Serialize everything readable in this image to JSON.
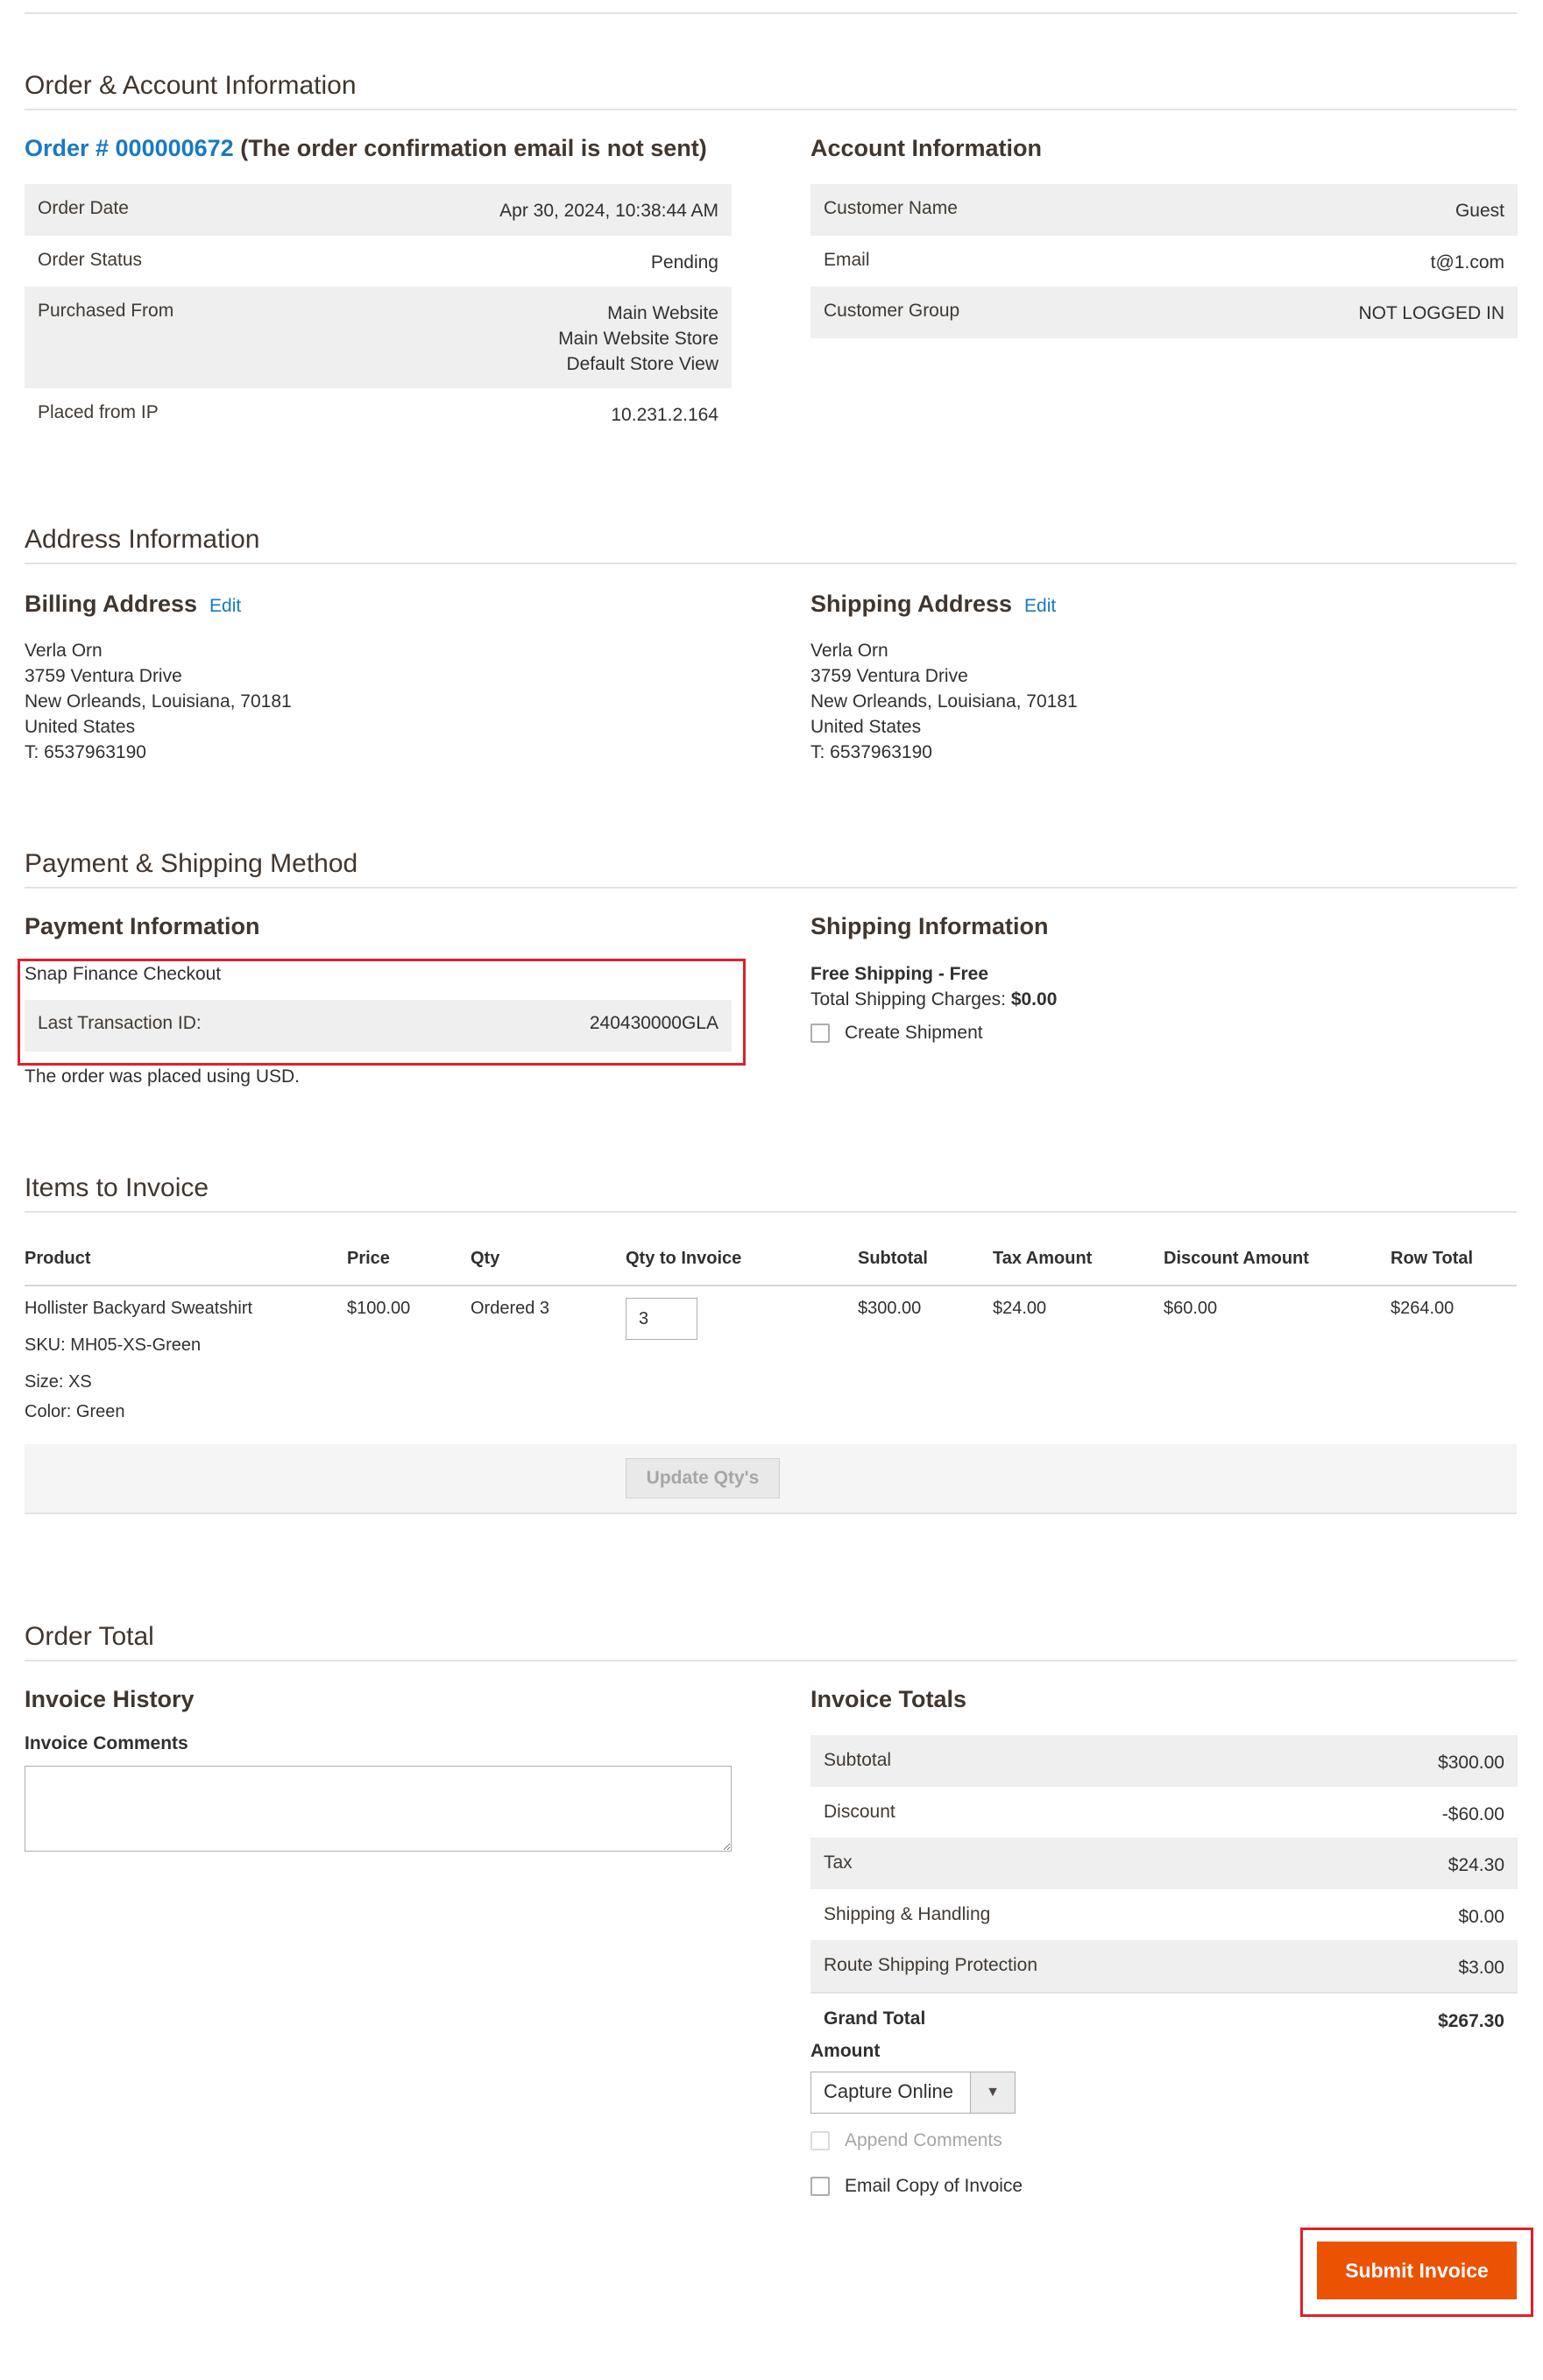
{
  "order_account": {
    "section_title": "Order & Account Information",
    "order_link": "Order # 000000672",
    "order_note": "(The order confirmation email is not sent)",
    "rows": [
      {
        "label": "Order Date",
        "value": "Apr 30, 2024, 10:38:44 AM"
      },
      {
        "label": "Order Status",
        "value": "Pending"
      },
      {
        "label": "Purchased From",
        "value": "Main Website\nMain Website Store\nDefault Store View"
      },
      {
        "label": "Placed from IP",
        "value": "10.231.2.164"
      }
    ],
    "account_title": "Account Information",
    "account_rows": [
      {
        "label": "Customer Name",
        "value": "Guest"
      },
      {
        "label": "Email",
        "value": "t@1.com"
      },
      {
        "label": "Customer Group",
        "value": "NOT LOGGED IN"
      }
    ]
  },
  "address": {
    "section_title": "Address Information",
    "edit_label": "Edit",
    "billing_title": "Billing Address",
    "billing_lines": "Verla Orn\n3759 Ventura Drive\nNew Orleands, Louisiana, 70181\nUnited States\nT: 6537963190",
    "shipping_title": "Shipping Address",
    "shipping_lines": "Verla Orn\n3759 Ventura Drive\nNew Orleands, Louisiana, 70181\nUnited States\nT: 6537963190"
  },
  "payment_shipping": {
    "section_title": "Payment & Shipping Method",
    "payment_title": "Payment Information",
    "payment_method": "Snap Finance Checkout",
    "transaction_label": "Last Transaction ID:",
    "transaction_value": "240430000GLA",
    "currency_note": "The order was placed using USD.",
    "shipping_title": "Shipping Information",
    "shipping_method": "Free Shipping - Free",
    "charges_label": "Total Shipping Charges:",
    "charges_value": "$0.00",
    "create_shipment_label": "Create Shipment"
  },
  "items": {
    "section_title": "Items to Invoice",
    "headers": [
      "Product",
      "Price",
      "Qty",
      "Qty to Invoice",
      "Subtotal",
      "Tax Amount",
      "Discount Amount",
      "Row Total"
    ],
    "row": {
      "product": "Hollister Backyard Sweatshirt",
      "sku": "SKU: MH05-XS-Green",
      "size": "Size: XS",
      "color": "Color: Green",
      "price": "$100.00",
      "qty": "Ordered 3",
      "qty_to_invoice": "3",
      "subtotal": "$300.00",
      "tax": "$24.00",
      "discount": "$60.00",
      "row_total": "$264.00"
    },
    "update_button": "Update Qty's"
  },
  "order_total": {
    "section_title": "Order Total",
    "history_title": "Invoice History",
    "comments_label": "Invoice Comments",
    "totals_title": "Invoice Totals",
    "totals_rows": [
      {
        "label": "Subtotal",
        "value": "$300.00"
      },
      {
        "label": "Discount",
        "value": "-$60.00"
      },
      {
        "label": "Tax",
        "value": "$24.30"
      },
      {
        "label": "Shipping & Handling",
        "value": "$0.00"
      },
      {
        "label": "Route Shipping Protection",
        "value": "$3.00"
      }
    ],
    "grand_total_label": "Grand Total",
    "grand_total_value": "$267.30",
    "amount_label": "Amount",
    "capture_option": "Capture Online",
    "append_comments_label": "Append Comments",
    "email_copy_label": "Email Copy of Invoice",
    "submit_label": "Submit Invoice"
  },
  "colors": {
    "accent_link": "#1979c3",
    "submit_button": "#eb5202",
    "highlight_box": "#e0202a",
    "row_shade": "#efefef"
  }
}
